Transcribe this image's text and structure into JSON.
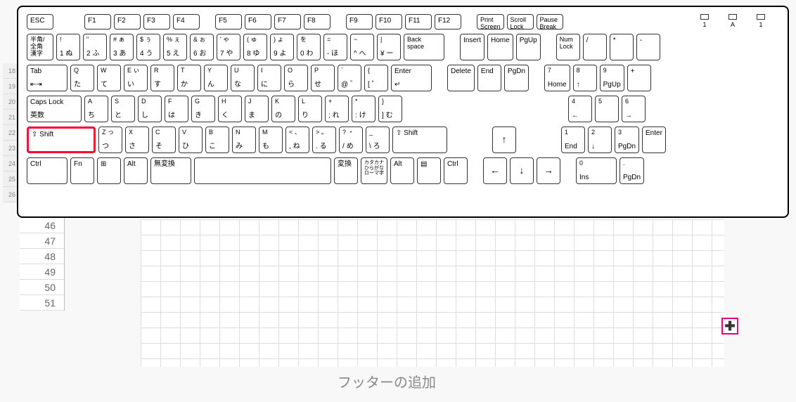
{
  "keyboard": {
    "row_fn": {
      "esc": "ESC",
      "fkeys": [
        "F1",
        "F2",
        "F3",
        "F4",
        "F5",
        "F6",
        "F7",
        "F8",
        "F9",
        "F10",
        "F11",
        "F12"
      ],
      "prtsc": "Print\nScreen",
      "scrlk": "Scroll\nLock",
      "pause": "Pause\nBreak"
    },
    "row_num": {
      "hankaku": "半角/\n全角\n漢字",
      "keys": [
        {
          "t": "!",
          "b": "1",
          "j": "ぬ"
        },
        {
          "t": "\"",
          "b": "2",
          "j": "ふ"
        },
        {
          "t": "#",
          "b": "3",
          "j": "あ",
          "j2": "ぁ"
        },
        {
          "t": "$",
          "b": "4",
          "j": "う",
          "j2": "ぅ"
        },
        {
          "t": "%",
          "b": "5",
          "j": "え",
          "j2": "ぇ"
        },
        {
          "t": "&",
          "b": "6",
          "j": "お",
          "j2": "ぉ"
        },
        {
          "t": "'",
          "b": "7",
          "j": "や",
          "j2": "ゃ"
        },
        {
          "t": "(",
          "b": "8",
          "j": "ゆ",
          "j2": "ゅ"
        },
        {
          "t": ")",
          "b": "9",
          "j": "よ",
          "j2": "ょ"
        },
        {
          "t": "",
          "b": "0",
          "j": "わ",
          "j2": "を"
        },
        {
          "t": "=",
          "b": "-",
          "j": "ほ"
        },
        {
          "t": "~",
          "b": "^",
          "j": "へ"
        },
        {
          "t": "|",
          "b": "¥",
          "j": "ー"
        }
      ],
      "backspace": "Back\nspace",
      "insert": "Insert",
      "home": "Home",
      "pgup": "PgUp",
      "numlock": "Num\nLock",
      "div": "/",
      "mul": "*",
      "sub": "-"
    },
    "row_q": {
      "tab": "Tab",
      "keys": [
        {
          "t": "Q",
          "j": "た"
        },
        {
          "t": "W",
          "j": "て"
        },
        {
          "t": "E",
          "j": "い",
          "j2": "ぃ"
        },
        {
          "t": "R",
          "j": "す"
        },
        {
          "t": "T",
          "j": "か"
        },
        {
          "t": "Y",
          "j": "ん"
        },
        {
          "t": "U",
          "j": "な"
        },
        {
          "t": "I",
          "j": "に"
        },
        {
          "t": "O",
          "j": "ら"
        },
        {
          "t": "P",
          "j": "せ"
        },
        {
          "t": "@",
          "j": "゛",
          "b": "`"
        },
        {
          "t": "[",
          "j": "゜",
          "b": "{"
        }
      ],
      "enter": "Enter",
      "delete": "Delete",
      "end": "End",
      "pgdn": "PgDn",
      "n7": "7",
      "n7s": "Home",
      "n8": "8",
      "n8s": "↑",
      "n9": "9",
      "n9s": "PgUp",
      "plus": "+"
    },
    "row_a": {
      "caps": "Caps Lock",
      "caps_sub": "英数",
      "keys": [
        {
          "t": "A",
          "j": "ち"
        },
        {
          "t": "S",
          "j": "と"
        },
        {
          "t": "D",
          "j": "し"
        },
        {
          "t": "F",
          "j": "は"
        },
        {
          "t": "G",
          "j": "き"
        },
        {
          "t": "H",
          "j": "く"
        },
        {
          "t": "J",
          "j": "ま"
        },
        {
          "t": "K",
          "j": "の"
        },
        {
          "t": "L",
          "j": "り"
        },
        {
          "t": ";",
          "b": "+",
          "j": "れ"
        },
        {
          "t": ":",
          "b": "*",
          "j": "け"
        },
        {
          "t": "]",
          "b": "}",
          "j": "む"
        }
      ],
      "n4": "4",
      "n4s": "←",
      "n5": "5",
      "n6": "6",
      "n6s": "→"
    },
    "row_z": {
      "lshift": "⇧ Shift",
      "keys": [
        {
          "t": "Z",
          "j": "つ",
          "j2": "っ"
        },
        {
          "t": "X",
          "j": "さ"
        },
        {
          "t": "C",
          "j": "そ"
        },
        {
          "t": "V",
          "j": "ひ"
        },
        {
          "t": "B",
          "j": "こ"
        },
        {
          "t": "N",
          "j": "み"
        },
        {
          "t": "M",
          "j": "も"
        },
        {
          "t": ",",
          "b": "<",
          "j": "ね",
          "j2": "、"
        },
        {
          "t": ".",
          "b": ">",
          "j": "る",
          "j2": "。"
        },
        {
          "t": "/",
          "b": "?",
          "j": "め",
          "j2": "・"
        },
        {
          "t": "\\",
          "b": "_",
          "j": "ろ"
        }
      ],
      "rshift": "⇧ Shift",
      "up": "↑",
      "n1": "1",
      "n1s": "End",
      "n2": "2",
      "n2s": "↓",
      "n3": "3",
      "n3s": "PgDn",
      "nenter": "Enter"
    },
    "row_ctrl": {
      "ctrl": "Ctrl",
      "fn": "Fn",
      "win": "⊞",
      "alt": "Alt",
      "muhenkan": "無変換",
      "space": "",
      "henkan": "変換",
      "kata": "カタカナ\nひらがな\nローマ字",
      "alt2": "Alt",
      "menu": "▤",
      "ctrl2": "Ctrl",
      "left": "←",
      "down": "↓",
      "right": "→",
      "n0": "0",
      "n0s": "Ins",
      "ndot": ".",
      "ndots": "PgDn"
    },
    "leds": [
      "1",
      "A",
      "1"
    ]
  },
  "sheet": {
    "ruler_v": [
      "18",
      "19",
      "20",
      "21",
      "22",
      "23",
      "24",
      "25",
      "26"
    ],
    "row_numbers": [
      "46",
      "47",
      "48",
      "49",
      "50",
      "51"
    ],
    "footer_placeholder": "フッターの追加",
    "cursor_glyph": "✚"
  }
}
